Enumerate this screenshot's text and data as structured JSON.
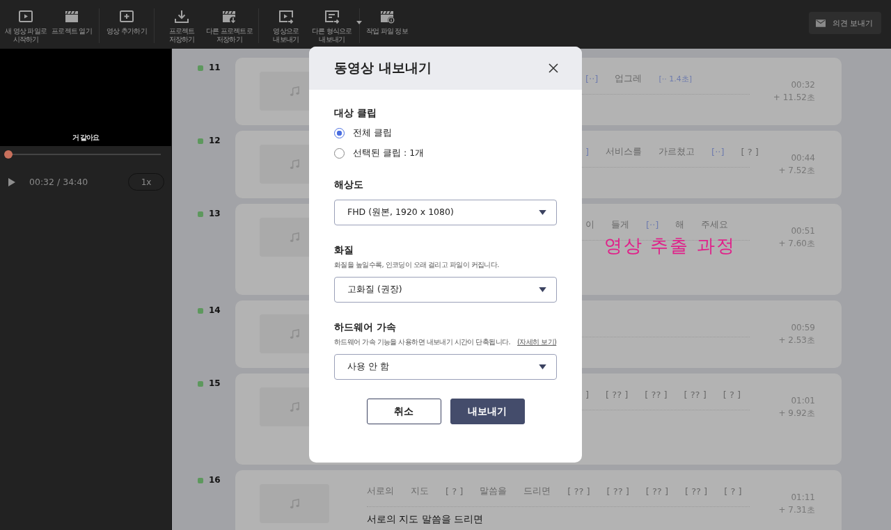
{
  "toolbar": {
    "groups": [
      [
        {
          "kind": "new-video",
          "label": "새 영상 파일로\n시작하기"
        },
        {
          "kind": "clapper",
          "label": "프로젝트 열기"
        }
      ],
      [
        {
          "kind": "add-video",
          "label": "영상 추가하기"
        }
      ],
      [
        {
          "kind": "download",
          "label": "프로젝트\n저장하기"
        },
        {
          "kind": "clapper-download",
          "label": "다른 프로젝트로\n저장하기"
        }
      ],
      [
        {
          "kind": "export-video",
          "label": "영상으로\n내보내기"
        },
        {
          "kind": "export-format",
          "label": "다른 형식으로\n내보내기",
          "menu": true
        }
      ],
      [
        {
          "kind": "clapper-info",
          "label": "작업 파일 정보"
        }
      ]
    ],
    "feedback_button": "의견 보내기"
  },
  "player": {
    "subtitle": "거 같아요",
    "level": 0.015,
    "time": "00:32 / 34:40",
    "speed": "1x"
  },
  "clips": [
    {
      "number": "11",
      "tokens": [
        {
          "kind": "gap",
          "text": "[··]"
        },
        {
          "kind": "word",
          "text": "업그레"
        },
        {
          "kind": "gap-timed",
          "text": "[·· 1.4초]"
        }
      ],
      "time": "00:32",
      "added": "+ 11.52초"
    },
    {
      "number": "12",
      "tokens": [
        {
          "kind": "gap",
          "text": "]"
        },
        {
          "kind": "word",
          "text": "서비스를"
        },
        {
          "kind": "word",
          "text": "가르쳤고"
        },
        {
          "kind": "gap",
          "text": "[··]"
        },
        {
          "kind": "word",
          "text": "[ ? ]"
        }
      ],
      "time": "00:44",
      "added": "+ 7.52초"
    },
    {
      "number": "13",
      "tokens": [
        {
          "kind": "word",
          "text": "이"
        },
        {
          "kind": "word",
          "text": "들게"
        },
        {
          "kind": "gap",
          "text": "[··]"
        },
        {
          "kind": "word",
          "text": "해"
        },
        {
          "kind": "word",
          "text": "주세요"
        }
      ],
      "time": "00:51",
      "added": "+ 7.60초"
    },
    {
      "number": "14",
      "time": "00:59",
      "added": "+ 2.53초"
    },
    {
      "number": "15",
      "tokens": [
        {
          "kind": "word",
          "text": "]"
        },
        {
          "kind": "word",
          "text": "[ ?? ]"
        },
        {
          "kind": "word",
          "text": "[ ?? ]"
        },
        {
          "kind": "word",
          "text": "[ ?? ]"
        },
        {
          "kind": "word",
          "text": "[ ? ]"
        }
      ],
      "time": "01:01",
      "added": "+ 9.92초"
    },
    {
      "number": "16",
      "tokens": [
        {
          "kind": "word",
          "text": "서로의"
        },
        {
          "kind": "word",
          "text": "지도"
        },
        {
          "kind": "word",
          "text": "[ ? ]"
        },
        {
          "kind": "word",
          "text": "말씀을"
        },
        {
          "kind": "word",
          "text": "드리면"
        },
        {
          "kind": "word",
          "text": "[ ?? ]"
        },
        {
          "kind": "word",
          "text": "[ ?? ]"
        },
        {
          "kind": "word",
          "text": "[ ?? ]"
        },
        {
          "kind": "word",
          "text": "[ ?? ]"
        },
        {
          "kind": "word",
          "text": "[ ? ]"
        }
      ],
      "transcript": "서로의 지도 말씀을 드리면",
      "time": "01:11",
      "added": "+ 7.31초"
    }
  ],
  "annotation": "영상 추출 과정",
  "dialog": {
    "title": "동영상 내보내기",
    "sections": [
      {
        "kind": "radio",
        "label": "대상 클립",
        "options": [
          {
            "label": "전체 클립",
            "selected": true
          },
          {
            "label": "선택된 클립 : 1개",
            "selected": false
          }
        ]
      },
      {
        "kind": "select",
        "label": "해상도",
        "value": "FHD (원본, 1920 x 1080)"
      },
      {
        "kind": "select",
        "label": "화질",
        "hint": "화질을 높일수록, 인코딩이 오래 걸리고 파일이 커집니다.",
        "value": "고화질 (권장)"
      },
      {
        "kind": "select",
        "label": "하드웨어 가속",
        "hint": "하드웨어 가속 기능을 사용하면 내보내기 시간이 단축됩니다.",
        "link": "(자세히 보기)",
        "value": "사용 안 함"
      }
    ],
    "cancel": "취소",
    "confirm": "내보내기"
  }
}
